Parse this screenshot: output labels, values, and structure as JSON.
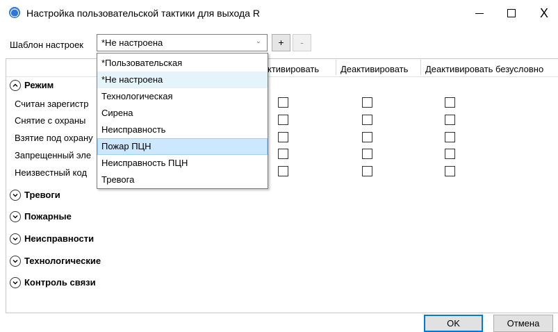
{
  "window": {
    "title": "Настройка пользовательской тактики для выхода R",
    "minimize_icon": "minimize-icon",
    "maximize_icon": "maximize-icon",
    "close_glyph": "X"
  },
  "template": {
    "label": "Шаблон настроек",
    "selected": "*Не настроена",
    "add_label": "+",
    "remove_label": "-",
    "options": [
      "*Пользовательская",
      "*Не настроена",
      "Технологическая",
      "Сирена",
      "Неисправность",
      "Пожар ПЦН",
      "Неисправность ПЦН",
      "Тревога"
    ],
    "selected_index": 1,
    "hover_index": 5
  },
  "columns": [
    "ктивировать",
    "Деактивировать",
    "Деактивировать безусловно"
  ],
  "groups": {
    "mode": {
      "label": "Режим",
      "expanded": true,
      "rows": [
        "Считан зарегистр",
        "Снятие с охраны",
        "Взятие под охрану",
        "Запрещенный эле",
        "Неизвестный код"
      ]
    },
    "alarms": {
      "label": "Тревоги",
      "expanded": false
    },
    "fire": {
      "label": "Пожарные",
      "expanded": false
    },
    "faults": {
      "label": "Неисправности",
      "expanded": false
    },
    "tech": {
      "label": "Технологические",
      "expanded": false
    },
    "link": {
      "label": "Контроль связи",
      "expanded": false
    }
  },
  "buttons": {
    "ok": "OK",
    "cancel": "Отмена"
  },
  "colors": {
    "accent": "#0078d7",
    "hover_bg": "#cce8ff",
    "hover_border": "#99d1ff",
    "selected_bg": "#e5f3fb"
  }
}
